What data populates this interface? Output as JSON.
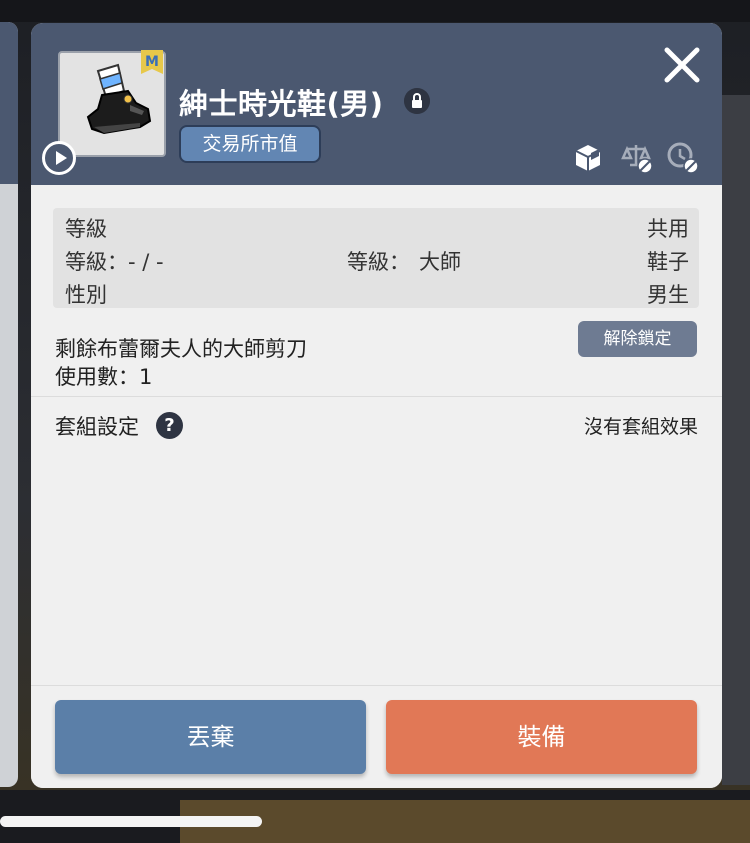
{
  "item": {
    "name": "紳士時光鞋(男)",
    "market_button": "交易所市值",
    "badge_letter": "M"
  },
  "stats": {
    "level_label": "等級",
    "level_value": "共用",
    "level_req_label": "等級：- / -",
    "grade_label": "等級：",
    "grade_value": "大師",
    "type_value": "鞋子",
    "gender_label": "性別",
    "gender_value": "男生"
  },
  "scissors": {
    "line1": "剩餘布蕾爾夫人的大師剪刀",
    "line2": "使用數：1",
    "unlock_button": "解除鎖定"
  },
  "set": {
    "label": "套組設定",
    "help_glyph": "?",
    "effect": "沒有套組效果"
  },
  "footer": {
    "discard_button": "丟棄",
    "equip_button": "裝備"
  },
  "colors": {
    "header": "#4b5870",
    "discard": "#5b7fa8",
    "equip": "#e17856",
    "market": "#6286b3"
  },
  "icons": {
    "close": "close-icon",
    "lock": "lock-icon",
    "play": "play-icon",
    "storage": "storage-box-icon",
    "trade": "scale-trade-disabled-icon",
    "reset": "reset-disabled-icon"
  }
}
